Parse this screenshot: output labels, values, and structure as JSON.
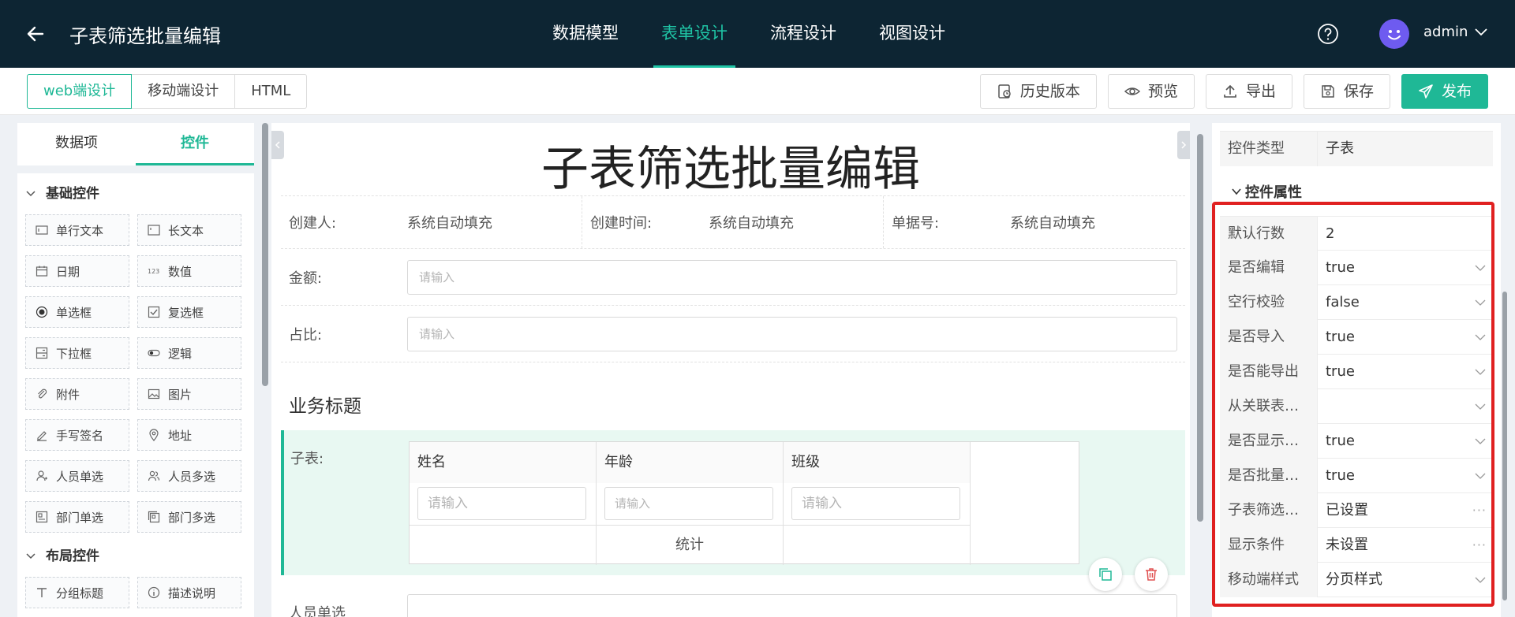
{
  "header": {
    "title": "子表筛选批量编辑",
    "nav_tabs": [
      {
        "label": "数据模型",
        "active": false
      },
      {
        "label": "表单设计",
        "active": true
      },
      {
        "label": "流程设计",
        "active": false
      },
      {
        "label": "视图设计",
        "active": false
      }
    ],
    "user_name": "admin",
    "icons": [
      "arrow-left-icon",
      "help-circle-icon",
      "avatar-smiley-icon",
      "chevron-down-icon"
    ]
  },
  "toolbar": {
    "modes": [
      {
        "label": "web端设计",
        "active": true
      },
      {
        "label": "移动端设计",
        "active": false
      },
      {
        "label": "HTML",
        "active": false
      }
    ],
    "actions": [
      {
        "label": "历史版本",
        "icon": "history-icon"
      },
      {
        "label": "预览",
        "icon": "eye-icon"
      },
      {
        "label": "导出",
        "icon": "upload-icon"
      },
      {
        "label": "保存",
        "icon": "save-icon"
      },
      {
        "label": "发布",
        "icon": "send-icon",
        "primary": true
      }
    ]
  },
  "left_panel": {
    "tabs": [
      {
        "label": "数据项",
        "active": false
      },
      {
        "label": "控件",
        "active": true
      }
    ],
    "groups": [
      {
        "title": "基础控件",
        "items": [
          {
            "label": "单行文本",
            "icon": "text-input-icon"
          },
          {
            "label": "长文本",
            "icon": "textarea-icon"
          },
          {
            "label": "日期",
            "icon": "calendar-icon"
          },
          {
            "label": "数值",
            "icon": "number-icon"
          },
          {
            "label": "单选框",
            "icon": "radio-icon"
          },
          {
            "label": "复选框",
            "icon": "checkbox-icon"
          },
          {
            "label": "下拉框",
            "icon": "dropdown-icon"
          },
          {
            "label": "逻辑",
            "icon": "toggle-icon"
          },
          {
            "label": "附件",
            "icon": "paperclip-icon"
          },
          {
            "label": "图片",
            "icon": "image-icon"
          },
          {
            "label": "手写签名",
            "icon": "pen-icon"
          },
          {
            "label": "地址",
            "icon": "location-icon"
          },
          {
            "label": "人员单选",
            "icon": "user-icon"
          },
          {
            "label": "人员多选",
            "icon": "users-icon"
          },
          {
            "label": "部门单选",
            "icon": "department-icon"
          },
          {
            "label": "部门多选",
            "icon": "departments-icon"
          }
        ]
      },
      {
        "title": "布局控件",
        "items": [
          {
            "label": "分组标题",
            "icon": "group-title-icon"
          },
          {
            "label": "描述说明",
            "icon": "description-icon"
          }
        ]
      }
    ]
  },
  "canvas": {
    "form_title": "子表筛选批量编辑",
    "meta": [
      {
        "label": "创建人:",
        "value": "系统自动填充"
      },
      {
        "label": "创建时间:",
        "value": "系统自动填充"
      },
      {
        "label": "单据号:",
        "value": "系统自动填充"
      }
    ],
    "fields": [
      {
        "label": "金额:",
        "placeholder": "请输入"
      },
      {
        "label": "占比:",
        "placeholder": "请输入"
      }
    ],
    "section_title": "业务标题",
    "subtable": {
      "label": "子表:",
      "columns": [
        "姓名",
        "年龄",
        "班级"
      ],
      "placeholders": [
        "请输入",
        "请输入",
        "请输入"
      ],
      "footer": [
        "",
        "统计",
        ""
      ]
    },
    "partial_label": "人员单选"
  },
  "right_panel": {
    "control_type": {
      "label": "控件类型",
      "value": "子表"
    },
    "section_title": "控件属性",
    "properties": [
      {
        "label": "默认行数",
        "value": "2",
        "kind": "text"
      },
      {
        "label": "是否编辑",
        "value": "true",
        "kind": "select"
      },
      {
        "label": "空行校验",
        "value": "false",
        "kind": "select"
      },
      {
        "label": "是否导入",
        "value": "true",
        "kind": "select"
      },
      {
        "label": "是否能导出",
        "value": "true",
        "kind": "select"
      },
      {
        "label": "从关联表…",
        "value": "",
        "kind": "select"
      },
      {
        "label": "是否显示…",
        "value": "true",
        "kind": "select"
      },
      {
        "label": "是否批量…",
        "value": "true",
        "kind": "select"
      },
      {
        "label": "子表筛选…",
        "value": "已设置",
        "kind": "more"
      },
      {
        "label": "显示条件",
        "value": "未设置",
        "kind": "more"
      },
      {
        "label": "移动端样式",
        "value": "分页样式",
        "kind": "select"
      }
    ]
  },
  "colors": {
    "nav_bg": "#0d2533",
    "accent": "#1fb896",
    "highlight": "#e02020",
    "avatar": "#6e5bf0"
  }
}
